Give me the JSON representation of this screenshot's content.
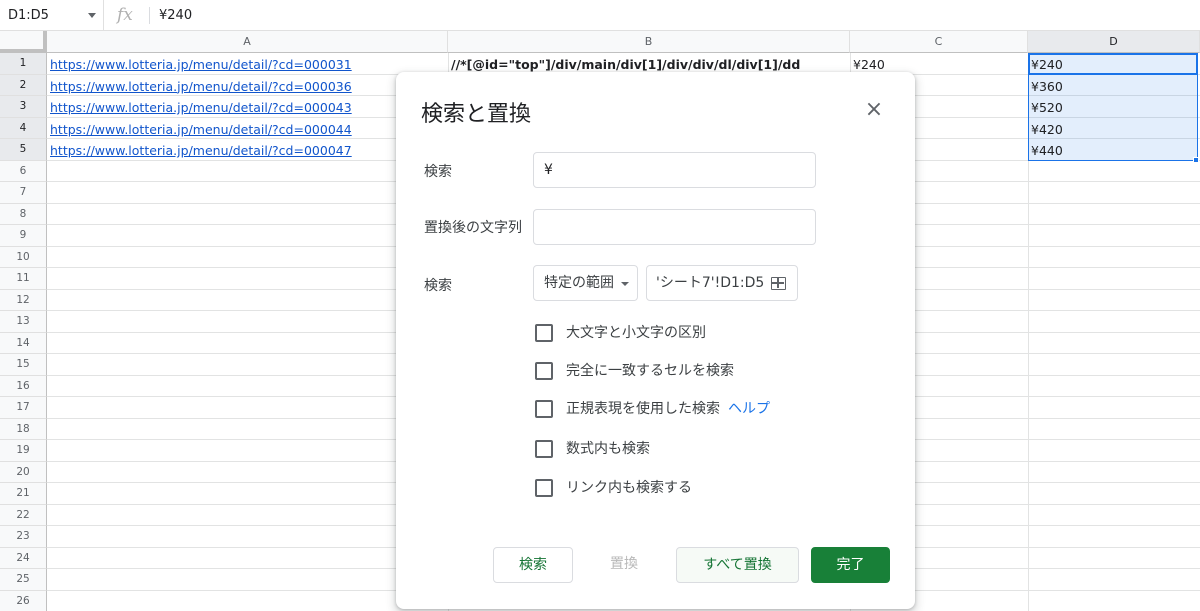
{
  "formula_bar": {
    "name_box": "D1:D5",
    "fx_symbol": "fx",
    "value": "¥240"
  },
  "sheet": {
    "columns": [
      "A",
      "B",
      "C",
      "D"
    ],
    "rows": [
      "1",
      "2",
      "3",
      "4",
      "5",
      "6",
      "7",
      "8",
      "9",
      "10",
      "11",
      "12",
      "13",
      "14",
      "15",
      "16",
      "17",
      "18",
      "19",
      "20",
      "21",
      "22",
      "23",
      "24",
      "25",
      "26"
    ],
    "col_a": [
      "https://www.lotteria.jp/menu/detail/?cd=000031",
      "https://www.lotteria.jp/menu/detail/?cd=000036",
      "https://www.lotteria.jp/menu/detail/?cd=000043",
      "https://www.lotteria.jp/menu/detail/?cd=000044",
      "https://www.lotteria.jp/menu/detail/?cd=000047"
    ],
    "b1": "//*[@id=\"top\"]/div/main/div[1]/div/div/dl/div[1]/dd",
    "c1": "¥240",
    "col_d": [
      "¥240",
      "¥360",
      "¥520",
      "¥420",
      "¥440"
    ]
  },
  "dialog": {
    "title": "検索と置換",
    "close_glyph": "×",
    "find_label": "検索",
    "find_value": "¥",
    "replace_label": "置換後の文字列",
    "replace_value": "",
    "scope_label": "検索",
    "scope_select": "特定の範囲",
    "scope_range": "'シート7'!D1:D5",
    "options": [
      {
        "label": "大文字と小文字の区別",
        "checked": false
      },
      {
        "label": "完全に一致するセルを検索",
        "checked": false
      },
      {
        "label": "正規表現を使用した検索",
        "checked": false
      },
      {
        "label": "数式内も検索",
        "checked": false
      },
      {
        "label": "リンク内も検索する",
        "checked": false
      }
    ],
    "help_link": "ヘルプ",
    "buttons": {
      "find": "検索",
      "replace": "置換",
      "replace_all": "すべて置換",
      "done": "完了"
    }
  }
}
